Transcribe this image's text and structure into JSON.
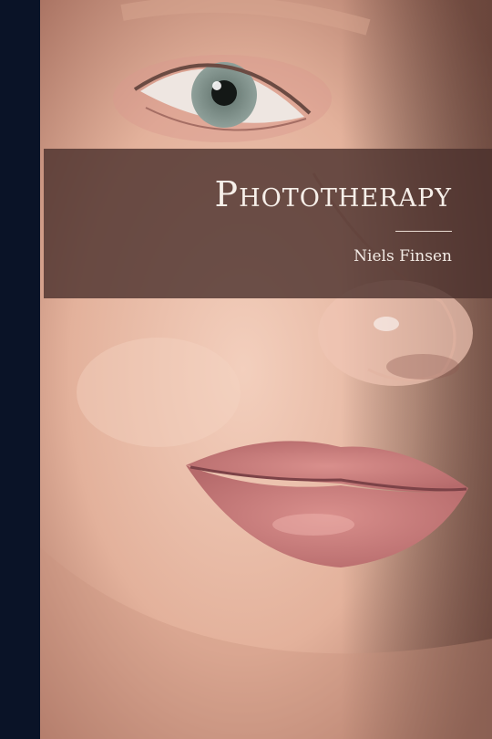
{
  "cover": {
    "title": "Phototherapy",
    "author": "Niels Finsen"
  },
  "colors": {
    "spine": "#0a1327",
    "band": "#4a302c",
    "text": "#f6efe9"
  }
}
